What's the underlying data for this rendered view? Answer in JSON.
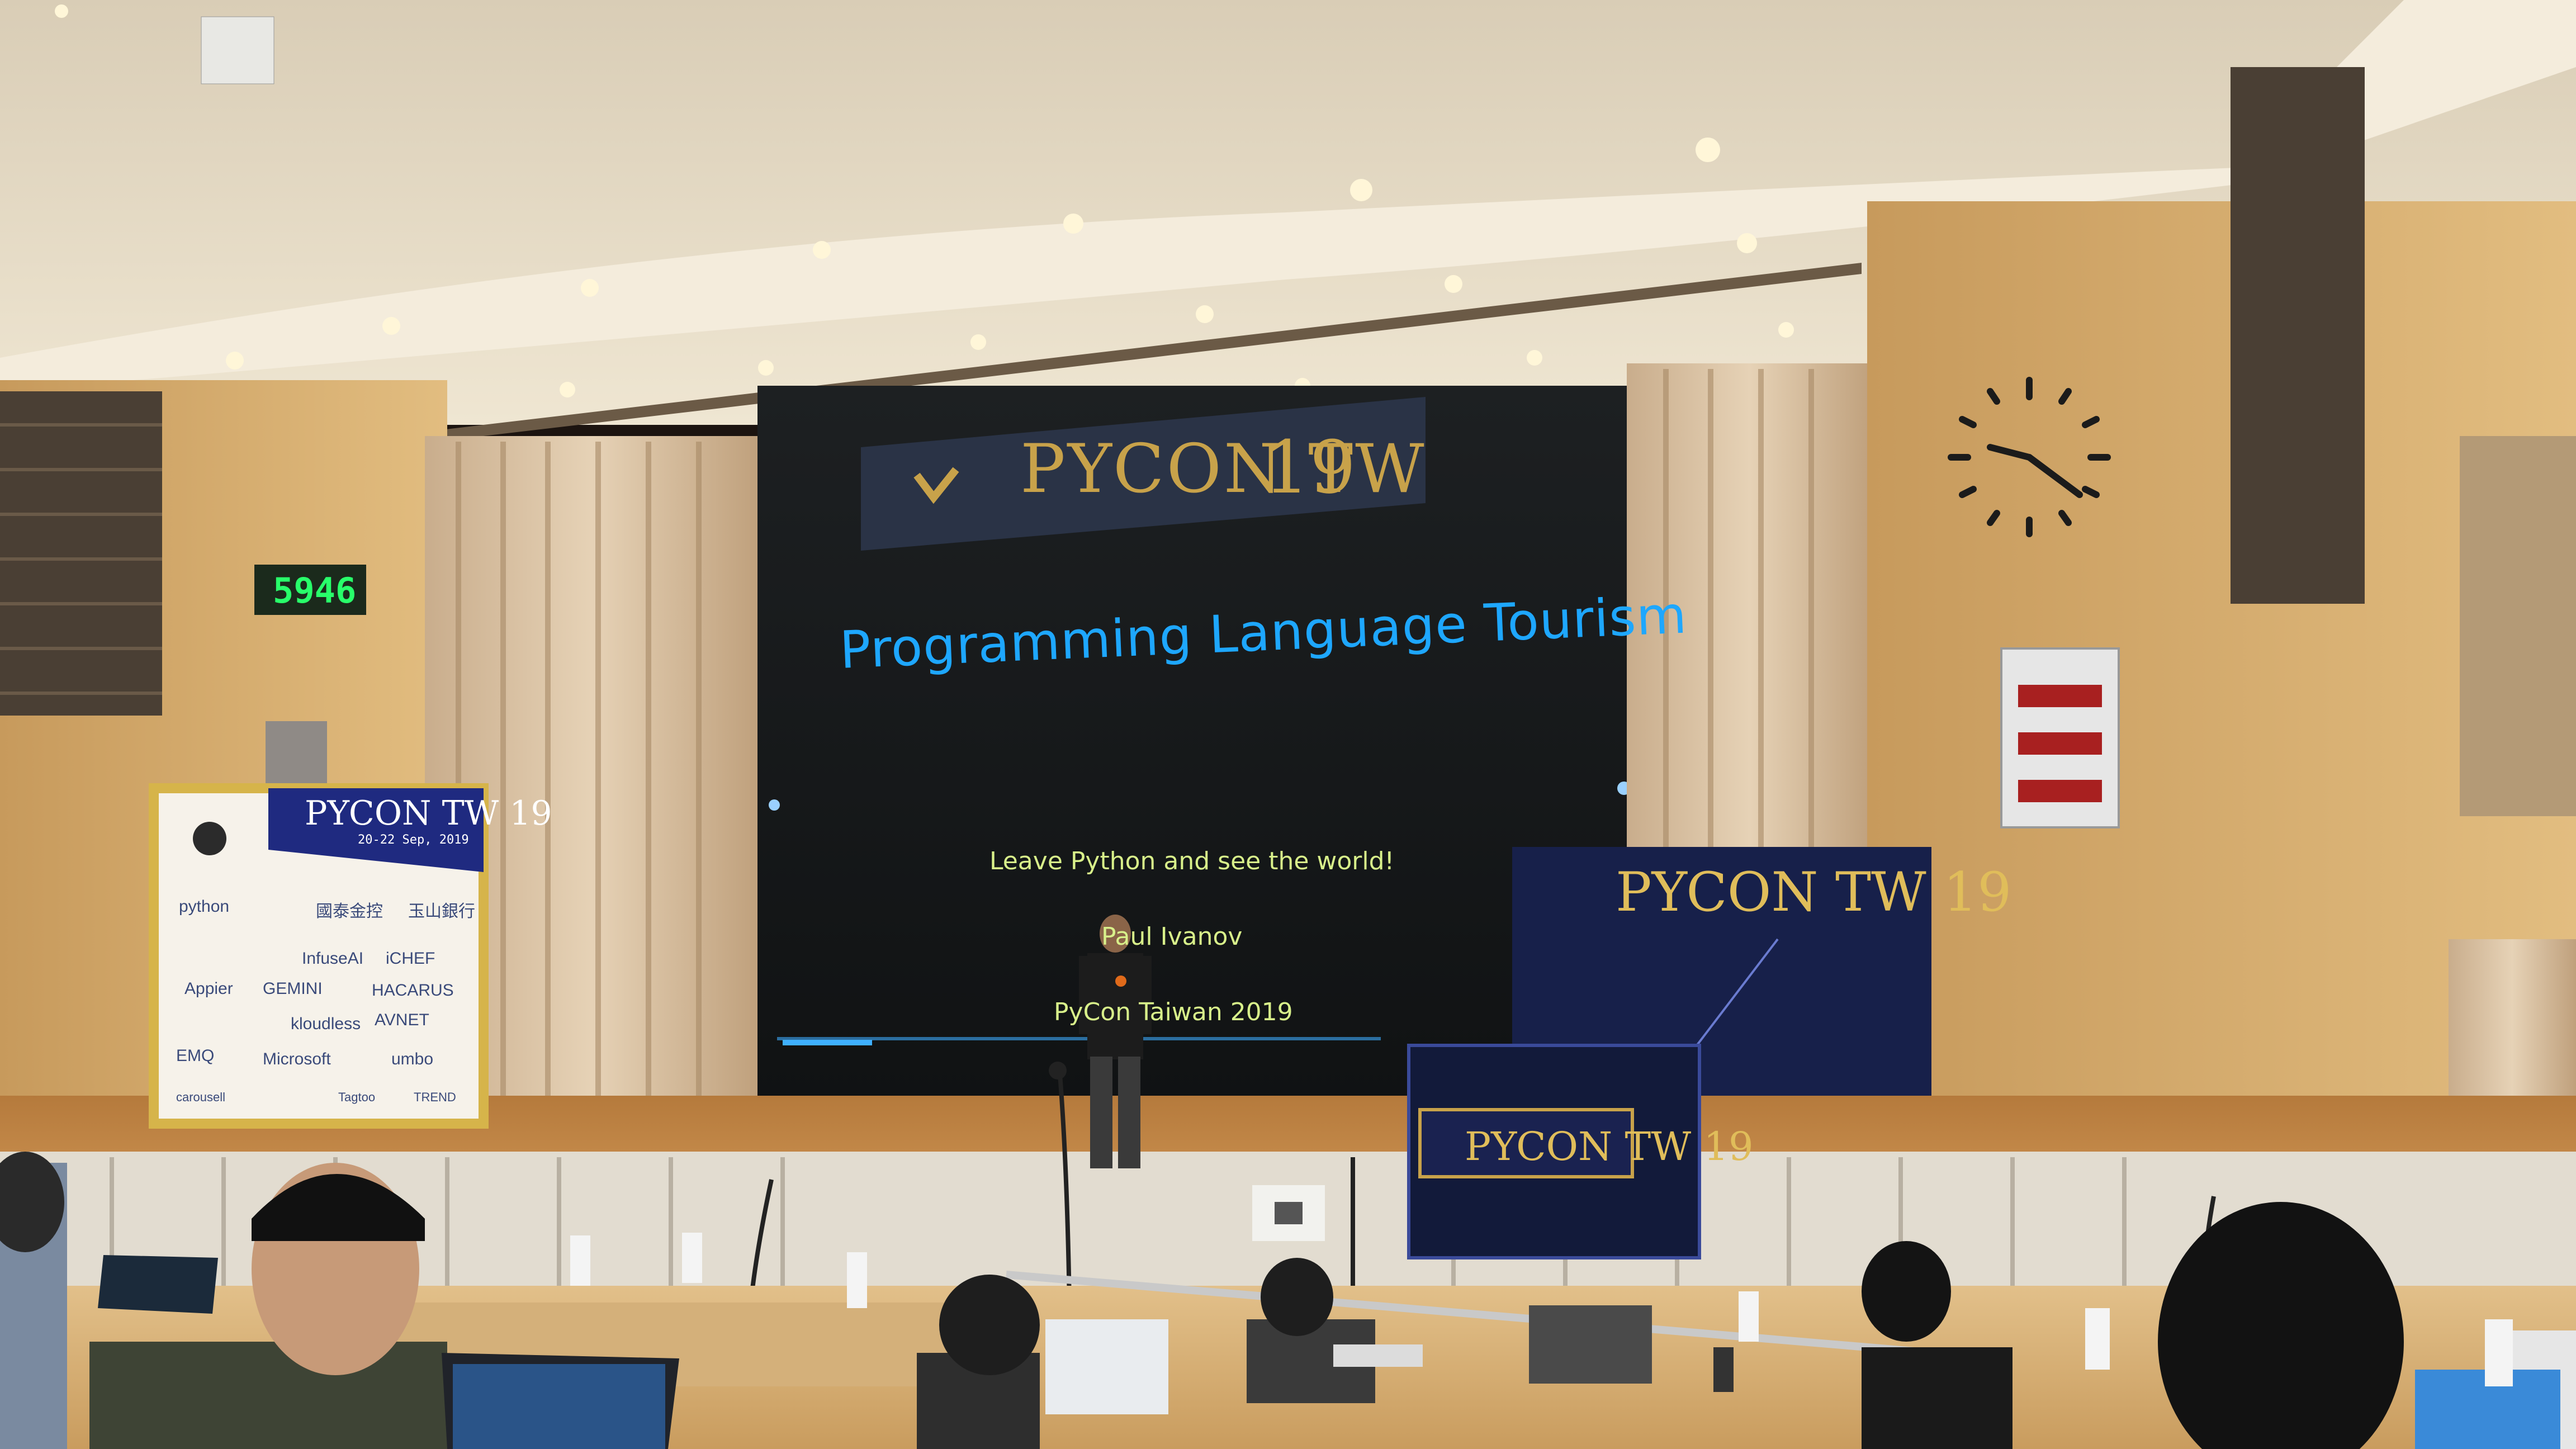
{
  "slide": {
    "title": "Programming Language Tourism",
    "subtitle": "Leave Python and see the world!",
    "speaker": "Paul Ivanov",
    "event": "PyCon Taiwan 2019"
  },
  "banner": {
    "logo_text": "PYCON TW",
    "year": "19"
  },
  "countdown": {
    "digits": "5946"
  },
  "standee": {
    "title": "PYCON TW 19",
    "dates": "20-22 Sep, 2019",
    "sponsors": [
      "python",
      "國泰金控",
      "玉山銀行",
      "InfuseAI",
      "iCHEF",
      "Appier",
      "GEMINI",
      "HACARUS",
      "kloudless",
      "AVNET",
      "EMQ",
      "Microsoft",
      "umbo",
      "carousell",
      "Tagtoo",
      "TREND"
    ]
  },
  "backdrop": {
    "title": "PYCON TW 19"
  },
  "podium": {
    "title": "PYCON TW 19"
  },
  "colors": {
    "slide_title": "#1ea7ff",
    "slide_text": "#d8f08a",
    "brand_gold": "#c8a24a",
    "brand_navy": "#1a2250"
  }
}
